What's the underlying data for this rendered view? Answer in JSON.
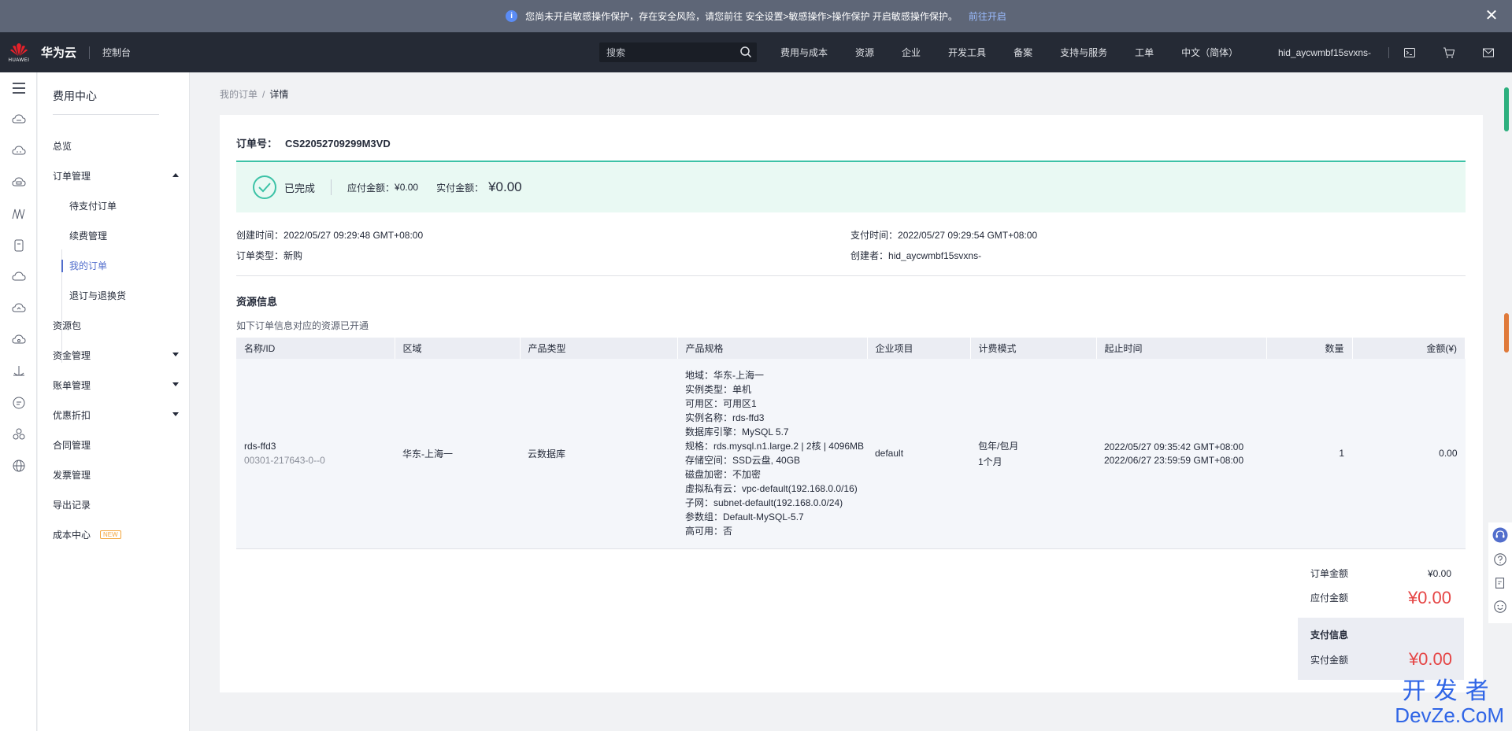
{
  "notice": {
    "text": "您尚未开启敏感操作保护，存在安全风险，请您前往 安全设置>敏感操作>操作保护 开启敏感操作保护。",
    "link": "前往开启"
  },
  "topbar": {
    "logo_text": "HUAWEI",
    "brand": "华为云",
    "console": "控制台",
    "search_placeholder": "搜索",
    "nav": [
      "费用与成本",
      "资源",
      "企业",
      "开发工具",
      "备案",
      "支持与服务",
      "工单",
      "中文（简体）"
    ],
    "user": "hid_aycwmbf15svxns-"
  },
  "sidebar": {
    "title": "费用中心",
    "items": [
      {
        "label": "总览"
      },
      {
        "label": "订单管理"
      },
      {
        "label": "待支付订单"
      },
      {
        "label": "续费管理"
      },
      {
        "label": "我的订单"
      },
      {
        "label": "退订与退换货"
      },
      {
        "label": "资源包"
      },
      {
        "label": "资金管理"
      },
      {
        "label": "账单管理"
      },
      {
        "label": "优惠折扣"
      },
      {
        "label": "合同管理"
      },
      {
        "label": "发票管理"
      },
      {
        "label": "导出记录"
      },
      {
        "label": "成本中心"
      }
    ],
    "new_badge": "NEW"
  },
  "breadcrumb": {
    "parent": "我的订单",
    "current": "详情"
  },
  "order": {
    "no_label": "订单号：",
    "no": "CS22052709299M3VD",
    "status": "已完成",
    "payable_label": "应付金额：",
    "payable": "¥0.00",
    "paid_label": "实付金额：",
    "paid": "¥0.00",
    "created_label": "创建时间：",
    "created": "2022/05/27 09:29:48 GMT+08:00",
    "type_label": "订单类型：",
    "type": "新购",
    "paytime_label": "支付时间：",
    "paytime": "2022/05/27 09:29:54 GMT+08:00",
    "creator_label": "创建者：",
    "creator": "hid_aycwmbf15svxns-"
  },
  "resources": {
    "title": "资源信息",
    "subtitle": "如下订单信息对应的资源已开通",
    "headers": [
      "名称/ID",
      "区域",
      "产品类型",
      "产品规格",
      "企业项目",
      "计费模式",
      "起止时间",
      "数量",
      "金额(¥)"
    ],
    "row": {
      "name": "rds-ffd3",
      "id": "00301-217643-0--0",
      "region": "华东-上海一",
      "product_type": "云数据库",
      "specs": [
        "地域：华东-上海一",
        "实例类型：单机",
        "可用区：可用区1",
        "实例名称：rds-ffd3",
        "数据库引擎：MySQL 5.7",
        "规格：rds.mysql.n1.large.2 | 2核 | 4096MB",
        "存储空间：SSD云盘, 40GB",
        "磁盘加密：不加密",
        "虚拟私有云：vpc-default(192.168.0.0/16)",
        "子网：subnet-default(192.168.0.0/24)",
        "参数组：Default-MySQL-5.7",
        "高可用：否"
      ],
      "project": "default",
      "billing": "包年/包月",
      "billing_period": "1个月",
      "start": "2022/05/27 09:35:42 GMT+08:00",
      "end": "2022/06/27 23:59:59 GMT+08:00",
      "qty": "1",
      "amount": "0.00"
    }
  },
  "totals": {
    "order_amount_label": "订单金额",
    "order_amount": "¥0.00",
    "payable_label": "应付金额",
    "payable": "¥0.00",
    "pay_info_title": "支付信息",
    "paid_label": "实付金额",
    "paid": "¥0.00"
  },
  "watermark": {
    "line1": "开发者",
    "line2": "DevZe.CoM"
  },
  "colors": {
    "accent": "#526ecc",
    "success": "#3cc2a6",
    "price": "#e54545",
    "topbar": "#252a35"
  }
}
